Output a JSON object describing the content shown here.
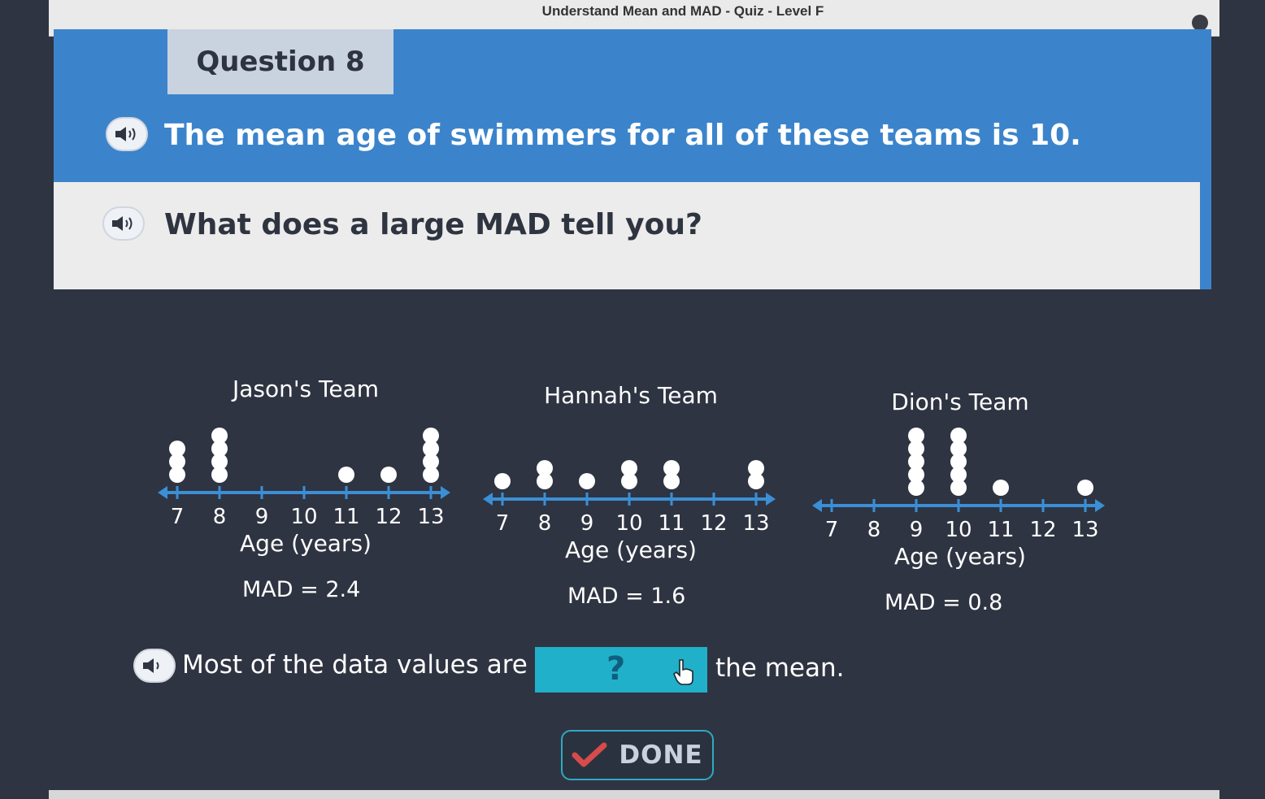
{
  "window": {
    "title": "Understand Mean and MAD - Quiz - Level F"
  },
  "question": {
    "number_label": "Question 8",
    "statement": "The mean age of swimmers for all of these teams is 10.",
    "prompt": "What does a large MAD tell you?"
  },
  "chart_data": [
    {
      "type": "dot",
      "title": "Jason's Team",
      "xlabel": "Age (years)",
      "ticks": [
        7,
        8,
        9,
        10,
        11,
        12,
        13
      ],
      "xlim": [
        7,
        13
      ],
      "counts": {
        "7": 3,
        "8": 4,
        "9": 0,
        "10": 0,
        "11": 1,
        "12": 1,
        "13": 4
      },
      "mad_label": "MAD = 2.4"
    },
    {
      "type": "dot",
      "title": "Hannah's Team",
      "xlabel": "Age (years)",
      "ticks": [
        7,
        8,
        9,
        10,
        11,
        12,
        13
      ],
      "xlim": [
        7,
        13
      ],
      "counts": {
        "7": 1,
        "8": 2,
        "9": 1,
        "10": 2,
        "11": 2,
        "12": 0,
        "13": 2
      },
      "mad_label": "MAD = 1.6"
    },
    {
      "type": "dot",
      "title": "Dion's Team",
      "xlabel": "Age (years)",
      "ticks": [
        7,
        8,
        9,
        10,
        11,
        12,
        13
      ],
      "xlim": [
        7,
        13
      ],
      "counts": {
        "7": 0,
        "8": 0,
        "9": 5,
        "10": 5,
        "11": 1,
        "12": 0,
        "13": 1
      },
      "mad_label": "MAD = 0.8"
    }
  ],
  "answer": {
    "before": "Most of the data values are",
    "placeholder": "?",
    "after": "the mean."
  },
  "done_label": "DONE",
  "icons": {
    "speaker": "speaker-icon",
    "hand": "hand-pointer-icon",
    "check": "checkmark-icon"
  },
  "colors": {
    "prompt_blue": "#3b84cc",
    "dropdown_teal": "#21b0c9",
    "axis_blue": "#3a8fd6",
    "check_red": "#d64b4b"
  }
}
